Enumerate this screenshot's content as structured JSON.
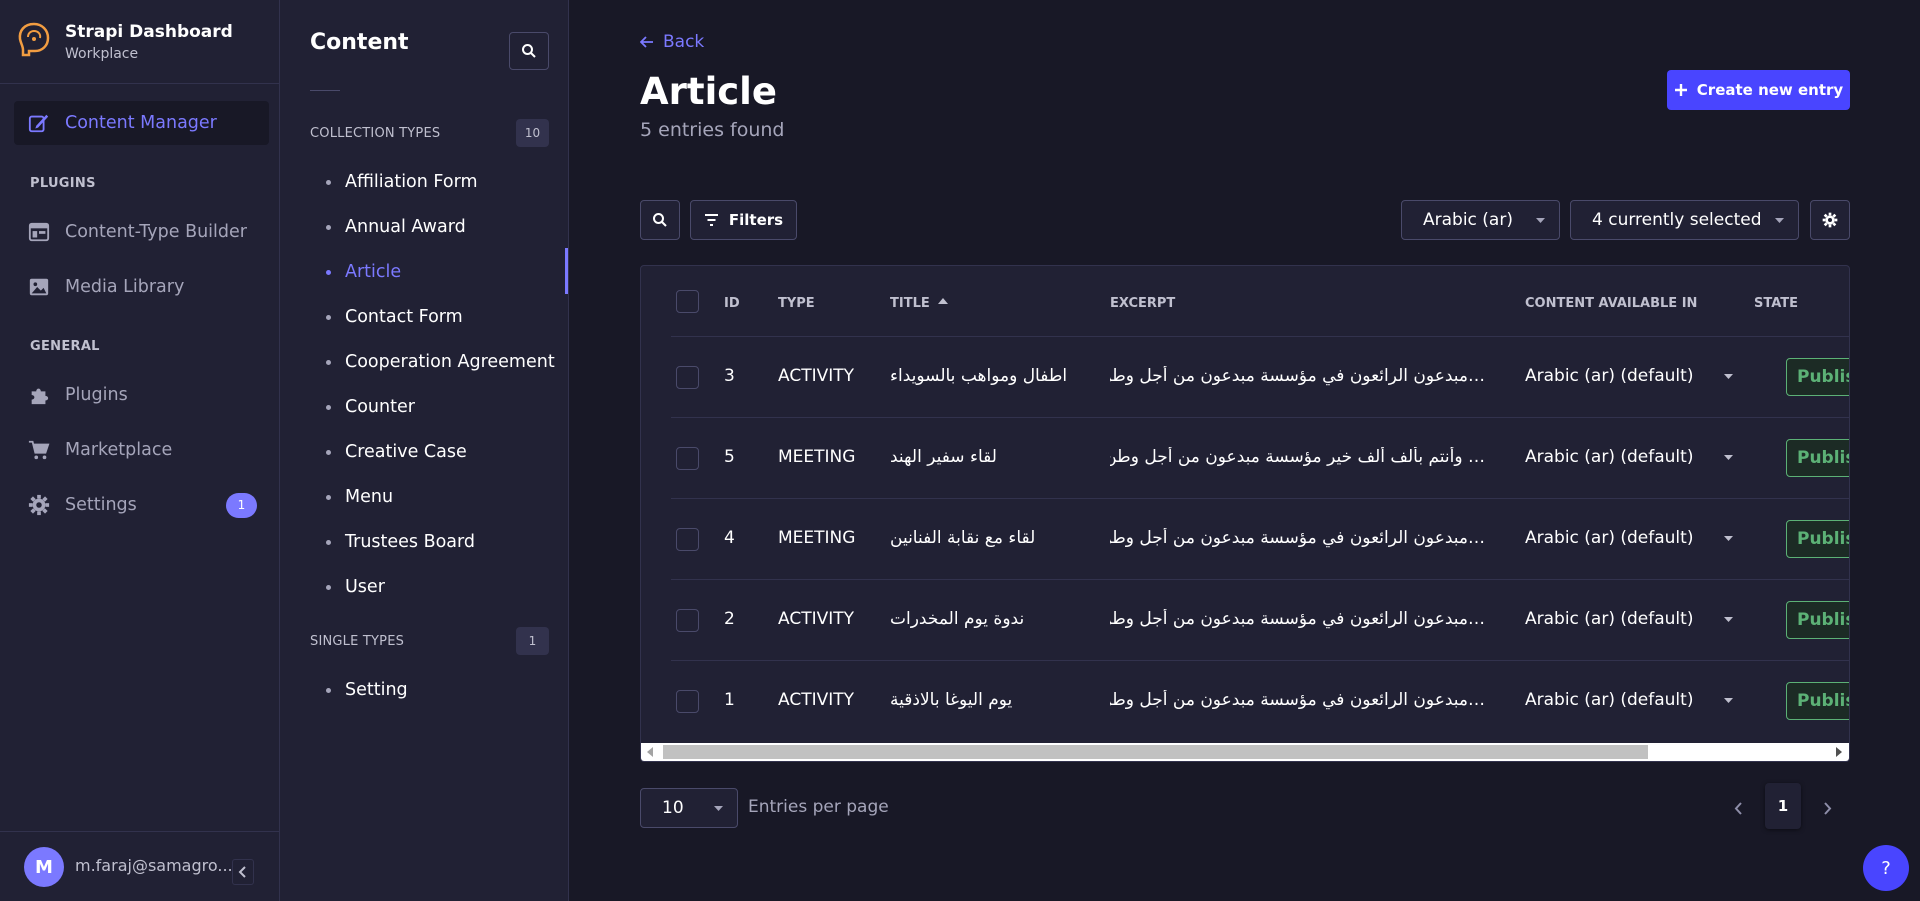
{
  "brand": {
    "title": "Strapi Dashboard",
    "subtitle": "Workplace"
  },
  "mainnav": {
    "content_manager": "Content Manager",
    "plugins_section": "PLUGINS",
    "content_type_builder": "Content-Type Builder",
    "media_library": "Media Library",
    "general_section": "GENERAL",
    "plugins": "Plugins",
    "marketplace": "Marketplace",
    "settings": "Settings",
    "settings_badge": "1"
  },
  "user": {
    "initial": "M",
    "email": "m.faraj@samagro..."
  },
  "subnav": {
    "title": "Content",
    "collection_section": "COLLECTION TYPES",
    "collection_count": "10",
    "collection_items": [
      "Affiliation Form",
      "Annual Award",
      "Article",
      "Contact Form",
      "Cooperation Agreement",
      "Counter",
      "Creative Case",
      "Menu",
      "Trustees Board",
      "User"
    ],
    "active_item": "Article",
    "single_section": "SINGLE TYPES",
    "single_count": "1",
    "single_items": [
      "Setting"
    ]
  },
  "header": {
    "back": "Back",
    "title": "Article",
    "subtitle": "5 entries found",
    "create_button": "Create new entry"
  },
  "toolbar": {
    "filters": "Filters",
    "locale": "Arabic (ar)",
    "columns": "4 currently selected"
  },
  "table": {
    "headers": {
      "id": "ID",
      "type": "TYPE",
      "title": "TITLE",
      "excerpt": "EXCERPT",
      "available": "CONTENT AVAILABLE IN",
      "state": "STATE"
    },
    "sort_column": "title",
    "sort_direction": "ascending",
    "rows": [
      {
        "id": "3",
        "type": "ACTIVITY",
        "title": "اطفال ومواهب بالسويداء",
        "excerpt": "…مبدعون الرائعون في مؤسسة مبدعون من أجل وطن",
        "available": "Arabic (ar) (default)",
        "state": "Published"
      },
      {
        "id": "5",
        "type": "MEETING",
        "title": "لقاء سفير الهند",
        "excerpt": "… وأنتم بألف ألف خير مؤسسة مبدعون من أجل وطن",
        "available": "Arabic (ar) (default)",
        "state": "Published"
      },
      {
        "id": "4",
        "type": "MEETING",
        "title": "لقاء مع نقابة الفنانين",
        "excerpt": "…مبدعون الرائعون في مؤسسة مبدعون من أجل وطن",
        "available": "Arabic (ar) (default)",
        "state": "Published"
      },
      {
        "id": "2",
        "type": "ACTIVITY",
        "title": "ندوة يوم المخدرات",
        "excerpt": "…مبدعون الرائعون في مؤسسة مبدعون من أجل وطن",
        "available": "Arabic (ar) (default)",
        "state": "Published"
      },
      {
        "id": "1",
        "type": "ACTIVITY",
        "title": "يوم اليوغا بالاذقية",
        "excerpt": "…مبدعون الرائعون في مؤسسة مبدعون من أجل وطن",
        "available": "Arabic (ar) (default)",
        "state": "Published"
      }
    ]
  },
  "footer": {
    "per_page": "10",
    "per_page_label": "Entries per page",
    "current_page": "1"
  },
  "help": "?",
  "colors": {
    "background": "#181826",
    "panel": "#212134",
    "border": "#32324d",
    "accent": "#7b79ff",
    "primary_button": "#4945ff",
    "published": "#5cb176"
  }
}
